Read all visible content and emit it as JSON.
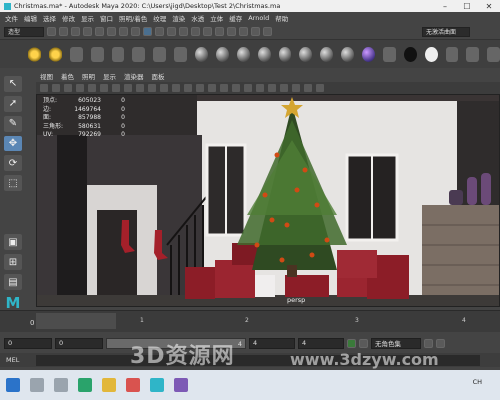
{
  "window": {
    "title": "Christmas.ma* - Autodesk Maya 2020: C:\\Users\\jigd\\Desktop\\Test 2\\Christmas.ma"
  },
  "menu": [
    "文件",
    "编辑",
    "创建",
    "选择",
    "修改",
    "显示",
    "窗口",
    "网格",
    "编辑网格",
    "网格工具",
    "网格显示",
    "曲线",
    "曲面",
    "变形",
    "UV",
    "生成",
    "缓存",
    "Arnold",
    "帮助"
  ],
  "menu_visible": [
    "文件",
    "编辑",
    "选择",
    "修改",
    "显示",
    "窗口",
    "照明/着色",
    "纹理",
    "渲染",
    "水透",
    "立体",
    "缓存",
    "Arnold",
    "帮助"
  ],
  "status": {
    "mode": "造型",
    "workspace": "无激活曲面"
  },
  "panel_menu": [
    "视图",
    "着色",
    "照明",
    "显示",
    "渲染器",
    "面板"
  ],
  "hud": [
    {
      "label": "顶点:",
      "value": "605023",
      "extra": "0"
    },
    {
      "label": "边:",
      "value": "1469764",
      "extra": "0"
    },
    {
      "label": "面:",
      "value": "857988",
      "extra": "0"
    },
    {
      "label": "三角形:",
      "value": "580631",
      "extra": "0"
    },
    {
      "label": "UV:",
      "value": "792269",
      "extra": "0"
    }
  ],
  "camera": "persp",
  "timeline": {
    "ticks": [
      "0",
      "1",
      "2",
      "3",
      "4"
    ],
    "current_frame": "0"
  },
  "range": {
    "start": "0",
    "anim_start": "0",
    "slider_end": "4",
    "end": "4",
    "anim_end": "4",
    "char_set": "无角色集"
  },
  "mel": {
    "label": "MEL"
  },
  "watermark": {
    "main": "3D资源网",
    "url": "www.3dzyw.com"
  },
  "taskbar": {
    "clock": "CH"
  }
}
